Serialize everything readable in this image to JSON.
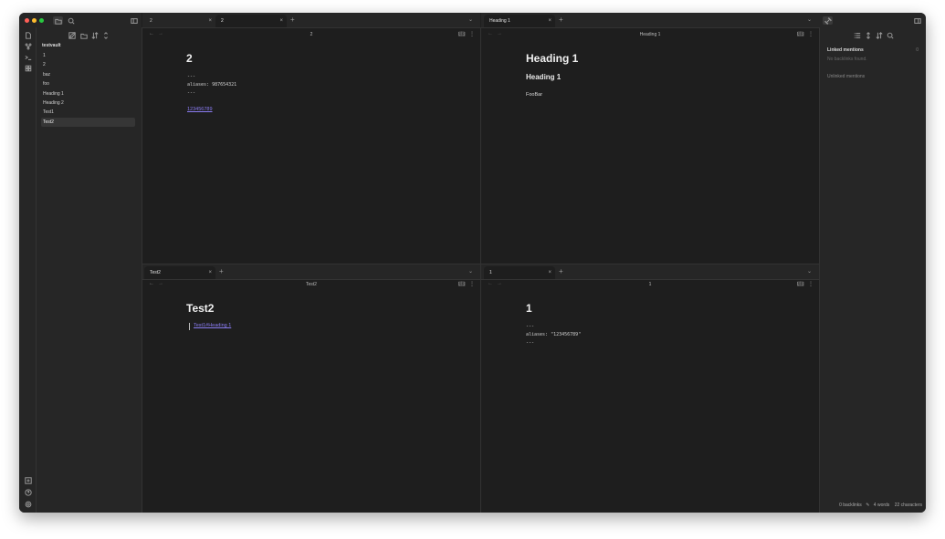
{
  "sidebar": {
    "vault_name": "testvault",
    "files": [
      "1",
      "2",
      "baz",
      "foo",
      "Heading 1",
      "Heading 2",
      "Test1",
      "Test2"
    ],
    "active_file": "Test2"
  },
  "panes": {
    "top_left": {
      "tabs": [
        {
          "label": "2"
        },
        {
          "label": "2"
        }
      ],
      "view_title": "2",
      "heading": "2",
      "frontmatter": [
        "---",
        "aliases: 987654321",
        "---"
      ],
      "link": "123456789"
    },
    "top_right": {
      "tabs": [
        {
          "label": "Heading 1"
        }
      ],
      "view_title": "Heading 1",
      "h1": "Heading 1",
      "h2": "Heading 1",
      "paragraph": "FooBar"
    },
    "bottom_left": {
      "tabs": [
        {
          "label": "Test2"
        }
      ],
      "view_title": "Test2",
      "heading": "Test2",
      "link": "Test1#Heading 1"
    },
    "bottom_right": {
      "tabs": [
        {
          "label": "1"
        }
      ],
      "view_title": "1",
      "heading": "1",
      "frontmatter": [
        "---",
        "aliases: \"123456789\"",
        "---"
      ]
    }
  },
  "backlinks": {
    "linked_title": "Linked mentions",
    "linked_count": "0",
    "no_backlinks": "No backlinks found.",
    "unlinked_title": "Unlinked mentions"
  },
  "status_bar": {
    "backlinks": "0 backlinks",
    "words": "4 words",
    "characters": "22 characters"
  },
  "icons": {
    "accent": "#8a7cf2"
  }
}
